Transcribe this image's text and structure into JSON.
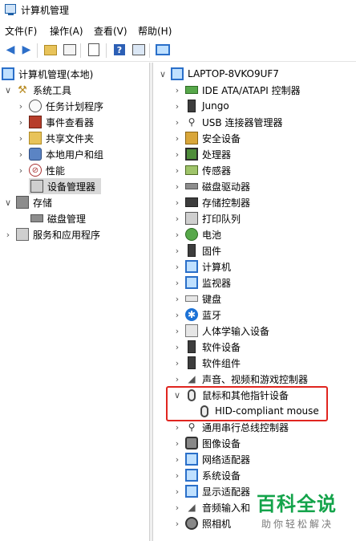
{
  "window": {
    "title": "计算机管理"
  },
  "menubar": {
    "items": [
      "文件(F)",
      "操作(A)",
      "查看(V)",
      "帮助(H)"
    ]
  },
  "toolbar": {
    "buttons": [
      "back-arrow-icon",
      "forward-arrow-icon",
      "up-folder-icon",
      "show-tree-icon",
      "properties-icon",
      "help-icon",
      "console-icon",
      "monitor-icon"
    ]
  },
  "left_tree": {
    "root": "计算机管理(本地)",
    "items": [
      {
        "label": "系统工具",
        "icon": "tools-icon"
      },
      {
        "label": "任务计划程序",
        "icon": "clock-icon"
      },
      {
        "label": "事件查看器",
        "icon": "event-viewer-icon"
      },
      {
        "label": "共享文件夹",
        "icon": "shared-folder-icon"
      },
      {
        "label": "本地用户和组",
        "icon": "users-icon"
      },
      {
        "label": "性能",
        "icon": "performance-icon"
      },
      {
        "label": "设备管理器",
        "icon": "device-manager-icon"
      },
      {
        "label": "存储",
        "icon": "storage-icon"
      },
      {
        "label": "磁盘管理",
        "icon": "disk-icon"
      },
      {
        "label": "服务和应用程序",
        "icon": "services-icon"
      }
    ]
  },
  "device_tree": {
    "computer": "LAPTOP-8VKO9UF7",
    "categories": [
      "IDE ATA/ATAPI 控制器",
      "Jungo",
      "USB 连接器管理器",
      "安全设备",
      "处理器",
      "传感器",
      "磁盘驱动器",
      "存储控制器",
      "打印队列",
      "电池",
      "固件",
      "计算机",
      "监视器",
      "键盘",
      "蓝牙",
      "人体学输入设备",
      "软件设备",
      "软件组件",
      "声音、视频和游戏控制器",
      "鼠标和其他指针设备",
      "通用串行总线控制器",
      "图像设备",
      "网络适配器",
      "系统设备",
      "显示适配器",
      "音频输入和",
      "照相机"
    ],
    "expanded_child": "HID-compliant mouse"
  },
  "watermark": {
    "main": "百科全说",
    "sub": "助你轻松解决"
  },
  "colors": {
    "highlight": "#e0251f",
    "watermark": "#13a34a",
    "selected": "#d9d9d9"
  }
}
